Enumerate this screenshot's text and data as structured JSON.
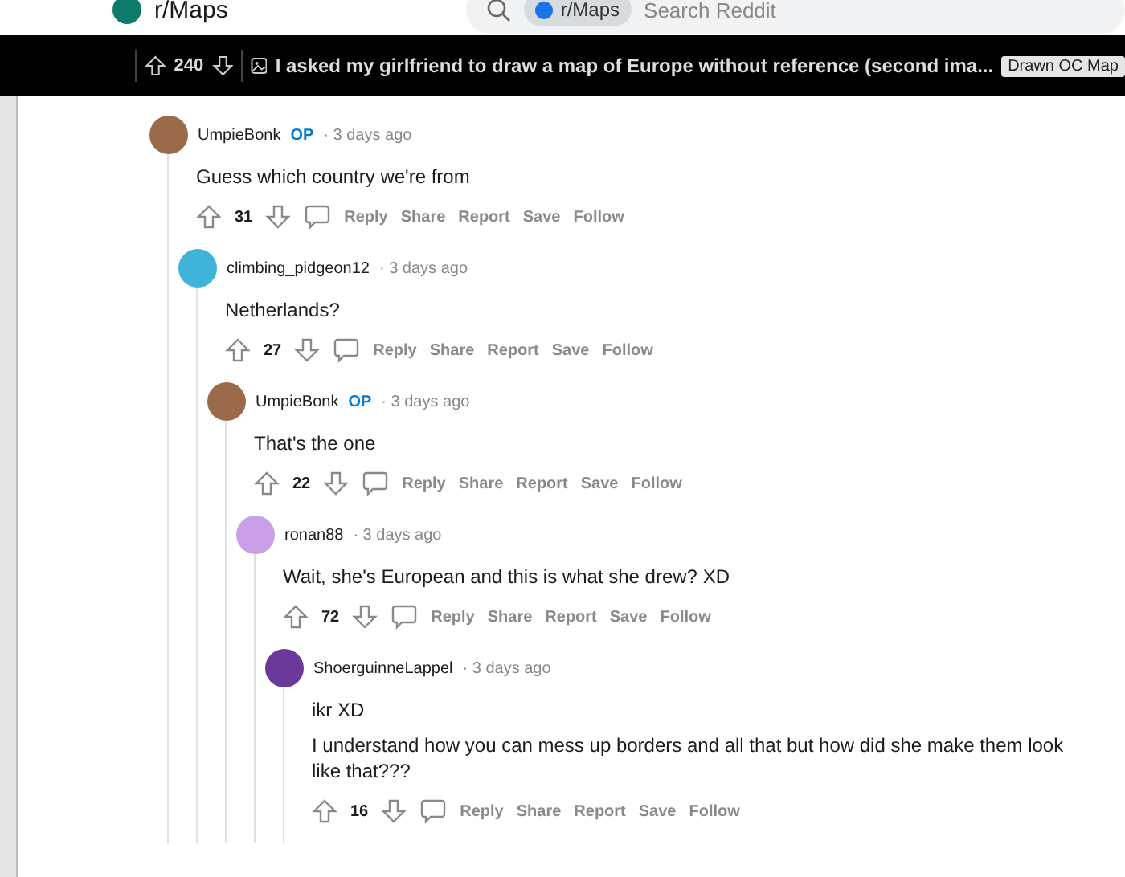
{
  "header": {
    "subreddit": "r/Maps",
    "search_chip": "r/Maps",
    "search_placeholder": "Search Reddit"
  },
  "post_bar": {
    "votes": "240",
    "title": "I asked my girlfriend to draw a map of Europe without reference (second ima...",
    "flair": "Drawn OC Map"
  },
  "comments": [
    {
      "author": "UmpieBonk",
      "op": true,
      "op_label": "OP",
      "time": "· 3 days ago",
      "color": "#9a6a4a",
      "body": [
        "Guess which country we're from"
      ],
      "votes": "31",
      "actions": [
        "Reply",
        "Share",
        "Report",
        "Save",
        "Follow"
      ],
      "children": [
        {
          "author": "climbing_pidgeon12",
          "op": false,
          "time": "· 3 days ago",
          "color": "#3fb3d8",
          "body": [
            "Netherlands?"
          ],
          "votes": "27",
          "actions": [
            "Reply",
            "Share",
            "Report",
            "Save",
            "Follow"
          ],
          "children": [
            {
              "author": "UmpieBonk",
              "op": true,
              "op_label": "OP",
              "time": "· 3 days ago",
              "color": "#9a6a4a",
              "body": [
                "That's the one"
              ],
              "votes": "22",
              "actions": [
                "Reply",
                "Share",
                "Report",
                "Save",
                "Follow"
              ],
              "children": [
                {
                  "author": "ronan88",
                  "op": false,
                  "time": "· 3 days ago",
                  "color": "#c9a0e8",
                  "body": [
                    "Wait, she's European and this is what she drew? XD"
                  ],
                  "votes": "72",
                  "actions": [
                    "Reply",
                    "Share",
                    "Report",
                    "Save",
                    "Follow"
                  ],
                  "children": [
                    {
                      "author": "ShoerguinneLappel",
                      "op": false,
                      "time": "· 3 days ago",
                      "color": "#6a3a9a",
                      "body": [
                        "ikr XD",
                        "I understand how you can mess up borders and all that but how did she make them look like that???"
                      ],
                      "votes": "16",
                      "actions": [
                        "Reply",
                        "Share",
                        "Report",
                        "Save",
                        "Follow"
                      ]
                    }
                  ]
                }
              ]
            }
          ]
        }
      ]
    }
  ]
}
